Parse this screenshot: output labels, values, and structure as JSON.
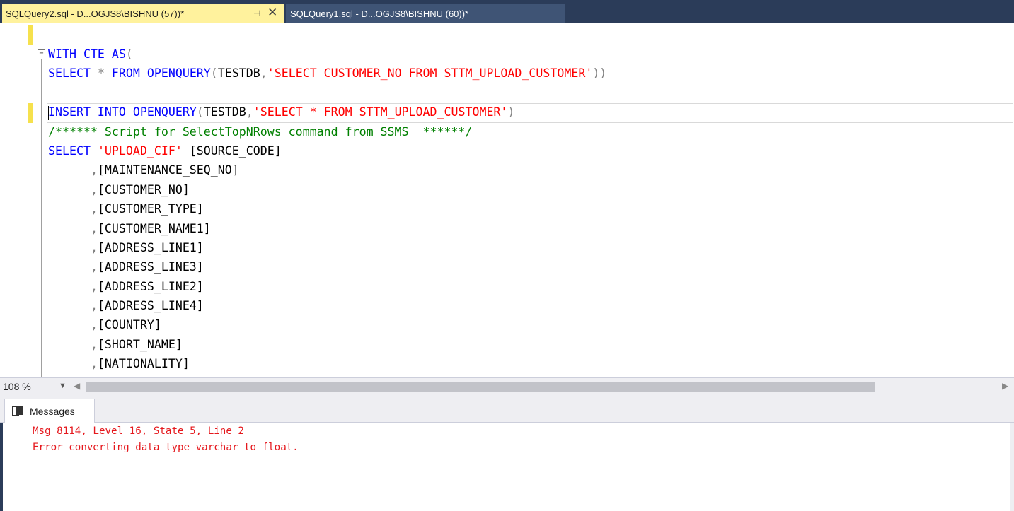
{
  "tabs": [
    {
      "title": "SQLQuery2.sql - D...OGJS8\\BISHNU (57))*",
      "active": true,
      "pin_icon": "pin-icon",
      "close_icon": "close-icon"
    },
    {
      "title": "SQLQuery1.sql - D...OGJS8\\BISHNU (60))*",
      "active": false
    }
  ],
  "editor": {
    "fold_symbol": "−",
    "lines": [
      {
        "parts": [
          {
            "t": "WITH CTE ",
            "c": "kw"
          },
          {
            "t": "AS",
            "c": "kw"
          },
          {
            "t": "(",
            "c": "gry"
          }
        ]
      },
      {
        "parts": [
          {
            "t": "SELECT ",
            "c": "kw"
          },
          {
            "t": "* ",
            "c": "gry"
          },
          {
            "t": "FROM ",
            "c": "kw"
          },
          {
            "t": "OPENQUERY",
            "c": "fn"
          },
          {
            "t": "(",
            "c": "gry"
          },
          {
            "t": "TESTDB",
            "c": ""
          },
          {
            "t": ",",
            "c": "gry"
          },
          {
            "t": "'SELECT CUSTOMER_NO FROM STTM_UPLOAD_CUSTOMER'",
            "c": "str"
          },
          {
            "t": "))",
            "c": "gry"
          }
        ]
      },
      {
        "parts": [
          {
            "t": "",
            "c": ""
          }
        ]
      },
      {
        "parts": [
          {
            "t": "INSERT INTO ",
            "c": "kw"
          },
          {
            "t": "OPENQUERY",
            "c": "fn"
          },
          {
            "t": "(",
            "c": "gry"
          },
          {
            "t": "TESTDB",
            "c": ""
          },
          {
            "t": ",",
            "c": "gry"
          },
          {
            "t": "'SELECT * FROM STTM_UPLOAD_CUSTOMER'",
            "c": "str"
          },
          {
            "t": ")",
            "c": "gry"
          }
        ]
      },
      {
        "parts": [
          {
            "t": "/****** Script for SelectTopNRows command from SSMS  ******/",
            "c": "cmt"
          }
        ]
      },
      {
        "parts": [
          {
            "t": "SELECT ",
            "c": "kw"
          },
          {
            "t": "'UPLOAD_CIF'",
            "c": "str"
          },
          {
            "t": " [SOURCE_CODE]",
            "c": ""
          }
        ]
      },
      {
        "parts": [
          {
            "t": "      ,",
            "c": "gry"
          },
          {
            "t": "[MAINTENANCE_SEQ_NO]",
            "c": ""
          }
        ]
      },
      {
        "parts": [
          {
            "t": "      ,",
            "c": "gry"
          },
          {
            "t": "[CUSTOMER_NO]",
            "c": ""
          }
        ]
      },
      {
        "parts": [
          {
            "t": "      ,",
            "c": "gry"
          },
          {
            "t": "[CUSTOMER_TYPE]",
            "c": ""
          }
        ]
      },
      {
        "parts": [
          {
            "t": "      ,",
            "c": "gry"
          },
          {
            "t": "[CUSTOMER_NAME1]",
            "c": ""
          }
        ]
      },
      {
        "parts": [
          {
            "t": "      ,",
            "c": "gry"
          },
          {
            "t": "[ADDRESS_LINE1]",
            "c": ""
          }
        ]
      },
      {
        "parts": [
          {
            "t": "      ,",
            "c": "gry"
          },
          {
            "t": "[ADDRESS_LINE3]",
            "c": ""
          }
        ]
      },
      {
        "parts": [
          {
            "t": "      ,",
            "c": "gry"
          },
          {
            "t": "[ADDRESS_LINE2]",
            "c": ""
          }
        ]
      },
      {
        "parts": [
          {
            "t": "      ,",
            "c": "gry"
          },
          {
            "t": "[ADDRESS_LINE4]",
            "c": ""
          }
        ]
      },
      {
        "parts": [
          {
            "t": "      ,",
            "c": "gry"
          },
          {
            "t": "[COUNTRY]",
            "c": ""
          }
        ]
      },
      {
        "parts": [
          {
            "t": "      ,",
            "c": "gry"
          },
          {
            "t": "[SHORT_NAME]",
            "c": ""
          }
        ]
      },
      {
        "parts": [
          {
            "t": "      ,",
            "c": "gry"
          },
          {
            "t": "[NATIONALITY]",
            "c": ""
          }
        ]
      }
    ]
  },
  "statusbar": {
    "zoom": "108 %",
    "zoom_arrow": "▼",
    "scroll_left": "◀",
    "scroll_right": "▶"
  },
  "messages": {
    "tab_label": "Messages",
    "tab_icon": "messages-icon",
    "lines": [
      "Msg 8114, Level 16, State 5, Line 2",
      "Error converting data type varchar to float."
    ]
  },
  "colors": {
    "tab_active_bg": "#fff29d",
    "tab_strip_bg": "#2b3c59",
    "keyword": "#0000ff",
    "string": "#ff0000",
    "comment": "#008000",
    "error": "#e5181d"
  }
}
